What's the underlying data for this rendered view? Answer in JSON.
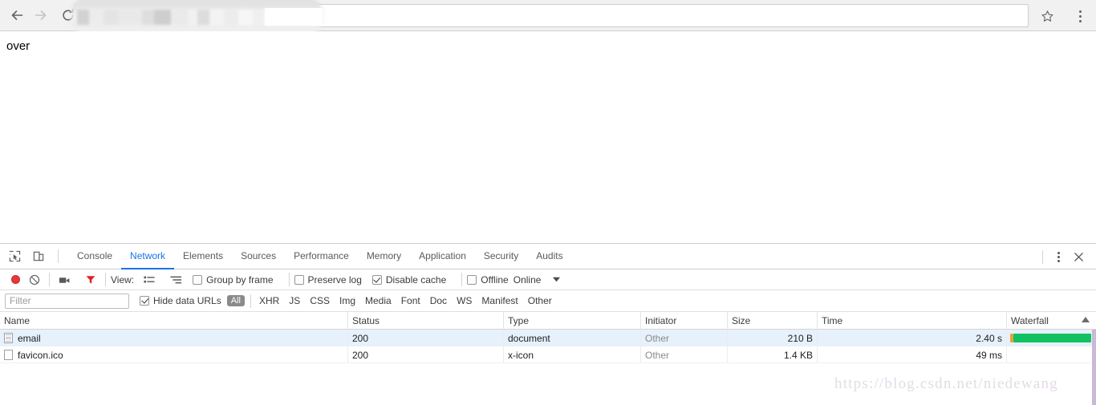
{
  "browser": {
    "nav": {
      "back_label": "Back",
      "forward_label": "Forward",
      "reload_label": "Reload"
    },
    "omnibox": {
      "value": "",
      "placeholder": "",
      "redacted": true
    },
    "star_label": "Bookmark this page",
    "menu_label": "Customize and control Google Chrome"
  },
  "page": {
    "body_text": "over"
  },
  "devtools": {
    "tabs": [
      {
        "label": "Console",
        "active": false
      },
      {
        "label": "Network",
        "active": true
      },
      {
        "label": "Elements",
        "active": false
      },
      {
        "label": "Sources",
        "active": false
      },
      {
        "label": "Performance",
        "active": false
      },
      {
        "label": "Memory",
        "active": false
      },
      {
        "label": "Application",
        "active": false
      },
      {
        "label": "Security",
        "active": false
      },
      {
        "label": "Audits",
        "active": false
      }
    ],
    "inspect_label": "Inspect element",
    "device_toolbar_label": "Toggle device toolbar",
    "more_label": "More options",
    "close_label": "Close DevTools",
    "toolbar": {
      "record_label": "Stop recording network log",
      "clear_label": "Clear",
      "screenshot_label": "Capture screenshots",
      "filter_label": "Filter",
      "view_label": "View:",
      "view_list_label": "Use large request rows",
      "view_waterfall_label": "Show overview",
      "group_by_frame": {
        "label": "Group by frame",
        "checked": false
      },
      "preserve_log": {
        "label": "Preserve log",
        "checked": false
      },
      "disable_cache": {
        "label": "Disable cache",
        "checked": true
      },
      "offline": {
        "label": "Offline",
        "checked": false
      },
      "throttling": {
        "label": "Online"
      }
    },
    "filterbar": {
      "filter_placeholder": "Filter",
      "filter_value": "",
      "hide_data_urls": {
        "label": "Hide data URLs",
        "checked": true
      },
      "types": [
        "All",
        "XHR",
        "JS",
        "CSS",
        "Img",
        "Media",
        "Font",
        "Doc",
        "WS",
        "Manifest",
        "Other"
      ],
      "active_type": "All"
    },
    "table": {
      "columns": [
        "Name",
        "Status",
        "Type",
        "Initiator",
        "Size",
        "Time",
        "Waterfall"
      ],
      "sort_column": "Waterfall",
      "sort_direction": "asc",
      "rows": [
        {
          "name": "email",
          "icon": "document-icon",
          "status": "200",
          "type": "document",
          "initiator": "Other",
          "size": "210 B",
          "time": "2.40 s",
          "selected": true,
          "waterfall": {
            "offset_pct": 0,
            "width_pct": 88,
            "wait_pct": 4,
            "color": "#12c162",
            "wait_color": "#e8a33d"
          }
        },
        {
          "name": "favicon.ico",
          "icon": "blank-file-icon",
          "status": "200",
          "type": "x-icon",
          "initiator": "Other",
          "size": "1.4 KB",
          "time": "49 ms",
          "selected": false,
          "waterfall": {
            "offset_pct": 0,
            "width_pct": 0,
            "wait_pct": 0,
            "color": "#12c162",
            "wait_color": "#e8a33d"
          }
        }
      ]
    }
  },
  "watermark": {
    "text": "https://blog.csdn.net/niedewang"
  }
}
